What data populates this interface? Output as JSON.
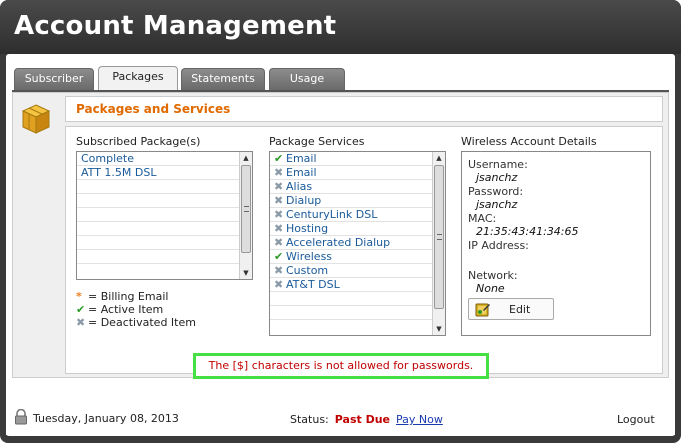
{
  "app": {
    "title": "Account Management"
  },
  "tabs": [
    {
      "label": "Subscriber",
      "active": false
    },
    {
      "label": "Packages",
      "active": true
    },
    {
      "label": "Statements",
      "active": false
    },
    {
      "label": "Usage",
      "active": false
    }
  ],
  "section": {
    "title": "Packages and Services",
    "icon": "package-box-icon"
  },
  "subscribed": {
    "label": "Subscribed Package(s)",
    "items": [
      "Complete",
      "ATT 1.5M DSL"
    ]
  },
  "services": {
    "label": "Package Services",
    "items": [
      {
        "name": "Email",
        "status": "active"
      },
      {
        "name": "Email",
        "status": "deactivated"
      },
      {
        "name": "Alias",
        "status": "deactivated"
      },
      {
        "name": "Dialup",
        "status": "deactivated"
      },
      {
        "name": "CenturyLink DSL",
        "status": "deactivated"
      },
      {
        "name": "Hosting",
        "status": "deactivated"
      },
      {
        "name": "Accelerated Dialup",
        "status": "deactivated"
      },
      {
        "name": "Wireless",
        "status": "active"
      },
      {
        "name": "Custom",
        "status": "deactivated"
      },
      {
        "name": "AT&T DSL",
        "status": "deactivated"
      }
    ]
  },
  "legend": {
    "billing": "= Billing Email",
    "active": "= Active Item",
    "deactivated": "= Deactivated Item"
  },
  "wireless": {
    "label": "Wireless Account Details",
    "username_label": "Username:",
    "username": "jsanchz",
    "password_label": "Password:",
    "password": "jsanchz",
    "mac_label": "MAC:",
    "mac": "21:35:43:41:34:65",
    "ip_label": "IP Address:",
    "network_label": "Network:",
    "network": "None",
    "edit_label": "Edit"
  },
  "error": {
    "message": "The [$] characters is not allowed for passwords."
  },
  "footer": {
    "date": "Tuesday, January 08, 2013",
    "status_label": "Status:",
    "status_value": "Past Due",
    "pay_now": "Pay Now",
    "logout": "Logout"
  },
  "colors": {
    "accent": "#e06a00",
    "error": "#c00000",
    "highlight": "#44e044",
    "link": "#1a5a9a"
  }
}
